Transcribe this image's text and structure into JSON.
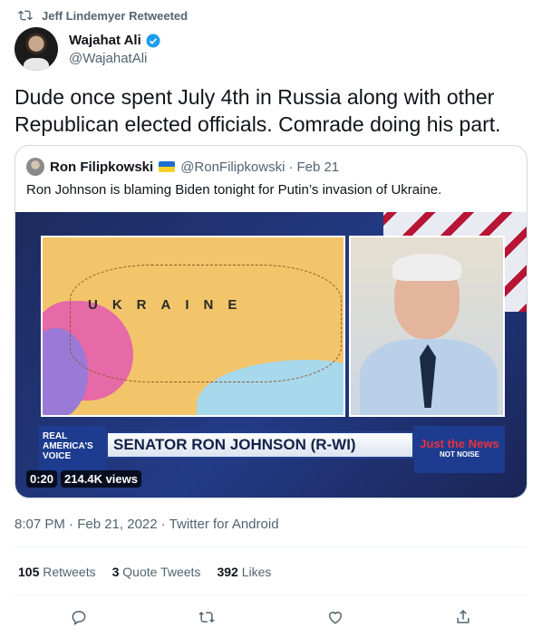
{
  "retweet_context": {
    "text": "Jeff Lindemyer Retweeted",
    "icon": "retweet-icon"
  },
  "author": {
    "display_name": "Wajahat Ali",
    "handle": "@WajahatAli",
    "verified": true,
    "verified_color": "#1d9bf0"
  },
  "tweet": {
    "text": "Dude once spent July 4th in Russia along with other Republican elected officials. Comrade doing his part."
  },
  "quote": {
    "name": "Ron Filipkowski",
    "flag_icon": "ukraine-flag-icon",
    "handle": "@RonFilipkowski",
    "separator": "·",
    "date": "Feb 21",
    "text": "Ron Johnson is blaming Biden tonight for Putin’s invasion of Ukraine.",
    "video": {
      "lower_third_title": "SENATOR RON JOHNSON (R-WI)",
      "brand_left": [
        "REAL",
        "AMERICA'S",
        "VOICE"
      ],
      "brand_right": {
        "main": "Just the News",
        "sub": "NOT NOISE"
      },
      "map_label": "UKRAINE",
      "duration": "0:20",
      "views": "214.4K views"
    }
  },
  "meta": {
    "timestamp": "8:07 PM · Feb 21, 2022 · Twitter for Android"
  },
  "stats": {
    "retweets_count": "105",
    "retweets_label": "Retweets",
    "quotes_count": "3",
    "quotes_label": "Quote Tweets",
    "likes_count": "392",
    "likes_label": "Likes"
  },
  "actions": [
    "reply-icon",
    "retweet-icon",
    "like-icon",
    "share-icon"
  ],
  "colors": {
    "text": "#0f1419",
    "secondary": "#536471",
    "border": "#cfd9de",
    "accent": "#1d9bf0"
  }
}
